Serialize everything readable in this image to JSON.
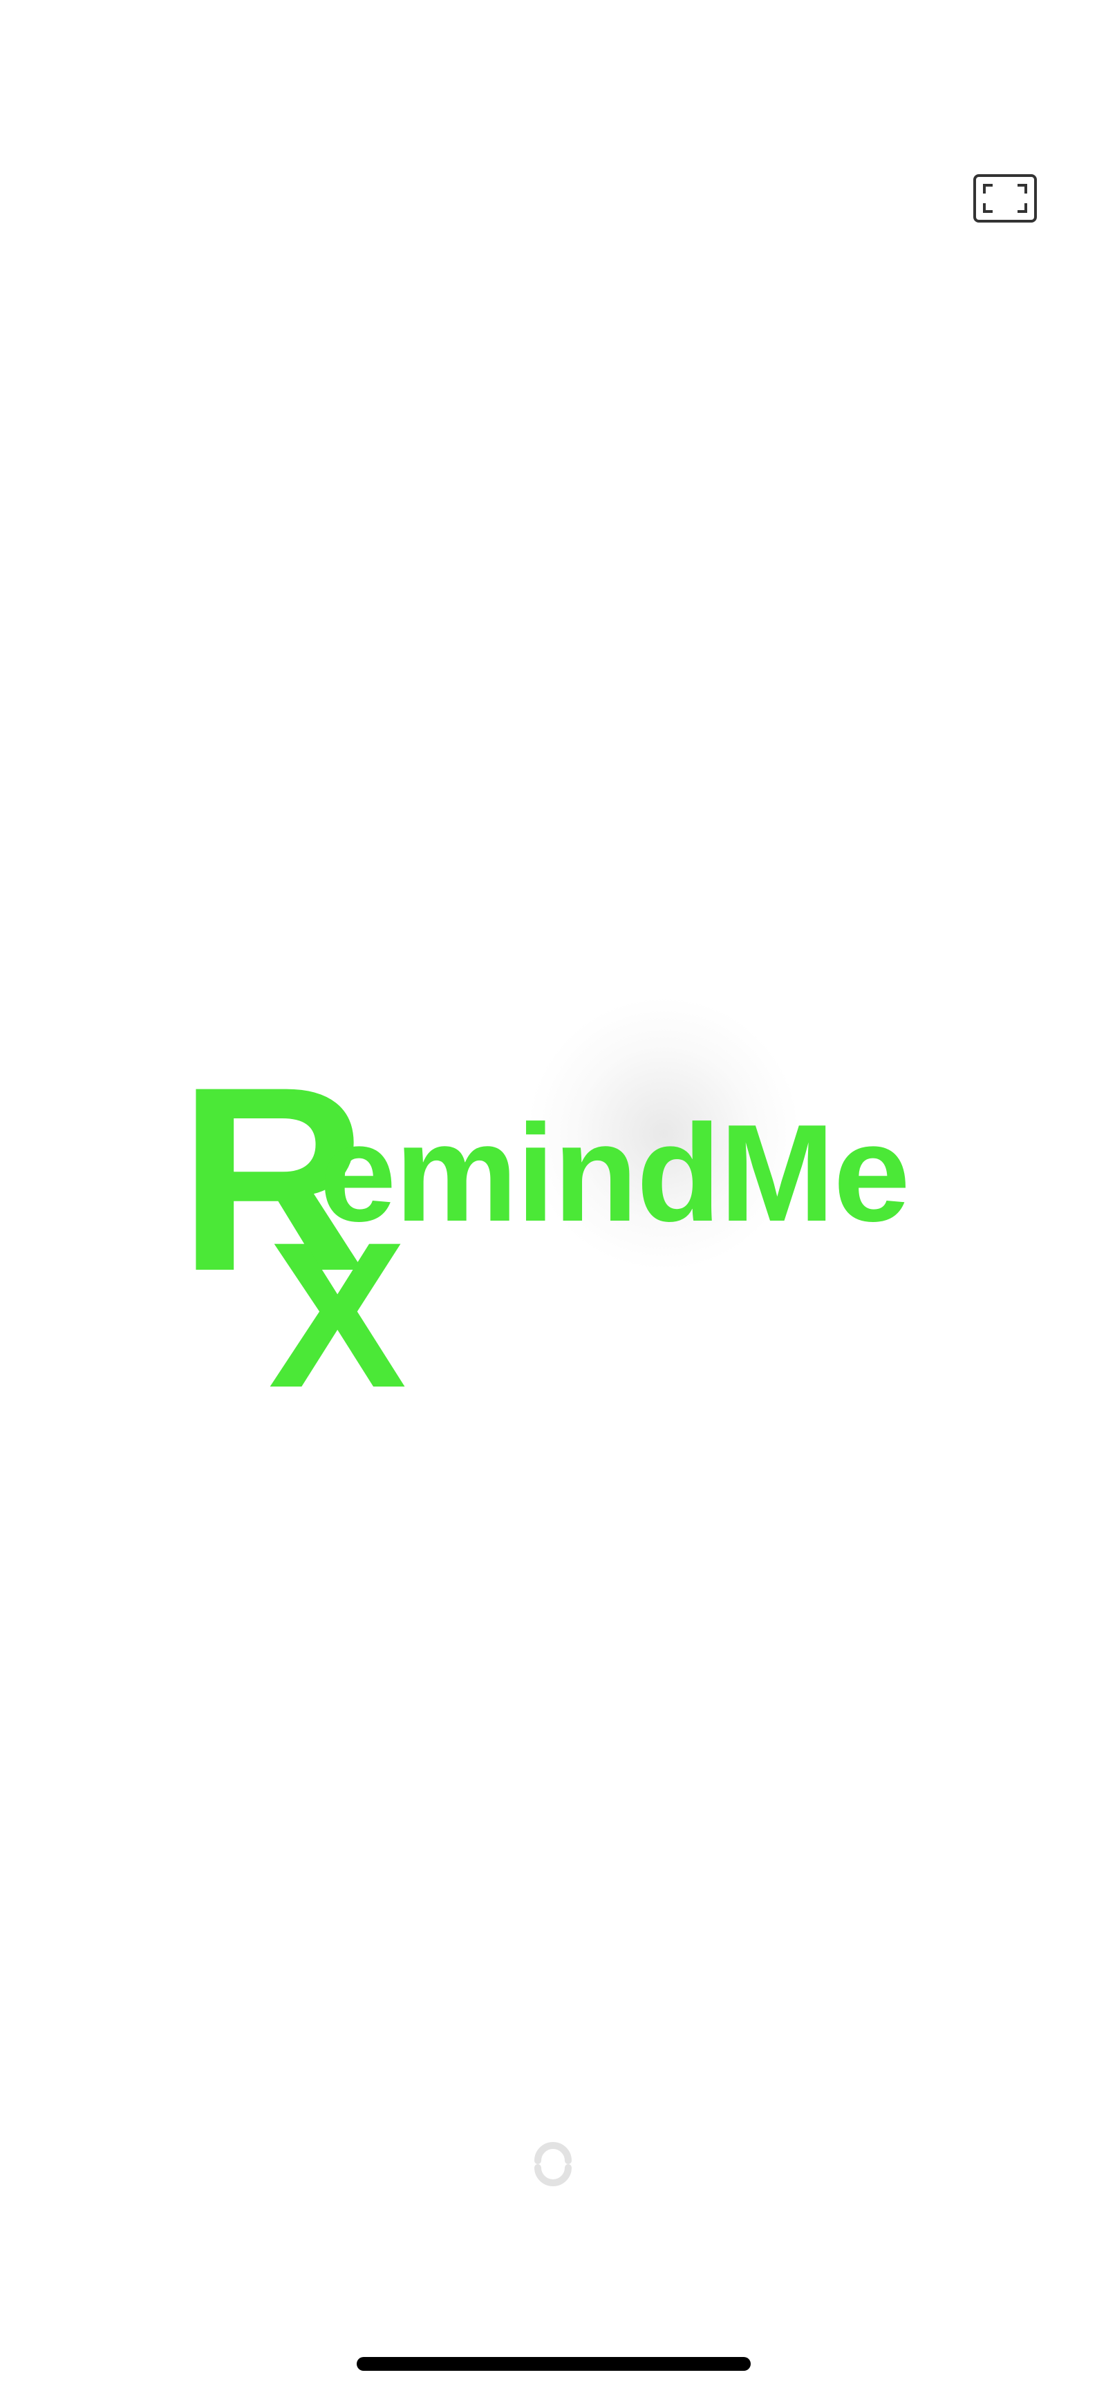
{
  "app": {
    "logo_r": "R",
    "logo_x": "X",
    "logo_word": "emindMe",
    "brand_color": "#4BE837"
  },
  "controls": {
    "expand_icon": "expand-icon",
    "spinner_icon": "loading-spinner-icon"
  }
}
